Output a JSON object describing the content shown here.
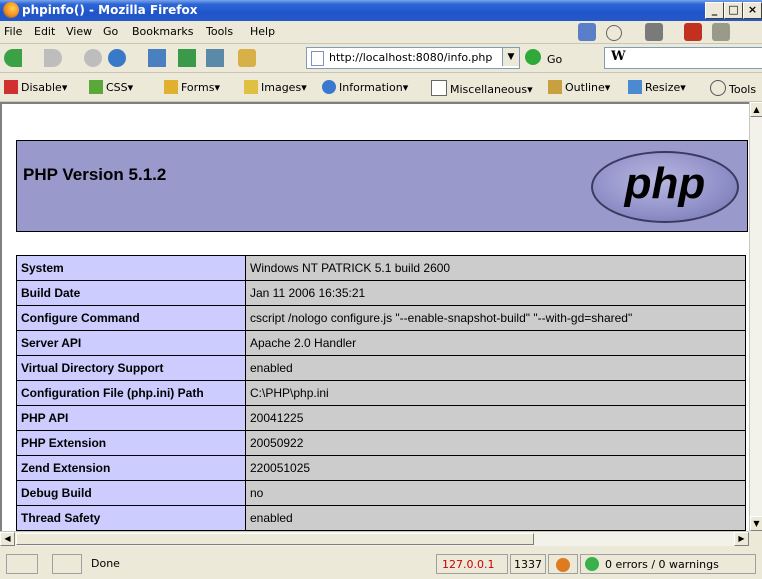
{
  "window": {
    "title": "phpinfo() - Mozilla Firefox",
    "min": "_",
    "max": "□",
    "close": "×"
  },
  "menu": [
    "File",
    "Edit",
    "View",
    "Go",
    "Bookmarks",
    "Tools",
    "Help"
  ],
  "nav": {
    "url": "http://localhost:8080/info.php",
    "go": "Go",
    "search": "W"
  },
  "devbar": [
    "Disable",
    "CSS",
    "Forms",
    "Images",
    "Information",
    "Miscellaneous",
    "Outline",
    "Resize",
    "Tools"
  ],
  "page": {
    "version": "PHP Version 5.1.2",
    "logo": "php",
    "rows": [
      {
        "key": "System",
        "value": "Windows NT PATRICK 5.1 build 2600"
      },
      {
        "key": "Build Date",
        "value": "Jan 11 2006 16:35:21"
      },
      {
        "key": "Configure Command",
        "value": "cscript /nologo configure.js \"--enable-snapshot-build\" \"--with-gd=shared\""
      },
      {
        "key": "Server API",
        "value": "Apache 2.0 Handler"
      },
      {
        "key": "Virtual Directory Support",
        "value": "enabled"
      },
      {
        "key": "Configuration File (php.ini) Path",
        "value": "C:\\PHP\\php.ini"
      },
      {
        "key": "PHP API",
        "value": "20041225"
      },
      {
        "key": "PHP Extension",
        "value": "20050922"
      },
      {
        "key": "Zend Extension",
        "value": "220051025"
      },
      {
        "key": "Debug Build",
        "value": "no"
      },
      {
        "key": "Thread Safety",
        "value": "enabled"
      }
    ]
  },
  "status": {
    "text": "Done",
    "ip": "127.0.0.1",
    "port": "1337",
    "errors": "0 errors / 0 warnings"
  },
  "colors": {
    "title_bar": "#2558c9",
    "header_bg": "#9999cc",
    "key_bg": "#ccccff",
    "value_bg": "#cccccc",
    "ip_text": "#cc0000"
  }
}
